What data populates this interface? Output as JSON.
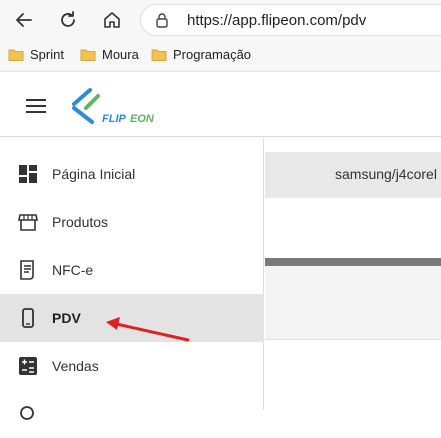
{
  "browser": {
    "url": "https://app.flipeon.com/pdv",
    "bookmarks": [
      {
        "label": "Sprint"
      },
      {
        "label": "Moura"
      },
      {
        "label": "Programação"
      }
    ]
  },
  "app": {
    "logo_text": "FLIPEON",
    "brand_colors": {
      "blue": "#2a8fd8",
      "green": "#5cb85c"
    }
  },
  "sidebar": {
    "items": [
      {
        "label": "Página Inicial",
        "icon": "dashboard-icon"
      },
      {
        "label": "Produtos",
        "icon": "store-icon"
      },
      {
        "label": "NFC-e",
        "icon": "receipt-icon"
      },
      {
        "label": "PDV",
        "icon": "smartphone-icon",
        "active": true
      },
      {
        "label": "Vendas",
        "icon": "calculator-icon"
      }
    ]
  },
  "content": {
    "device_label": "samsung/j4corel"
  },
  "annotation": {
    "arrow_color": "#e02020"
  }
}
